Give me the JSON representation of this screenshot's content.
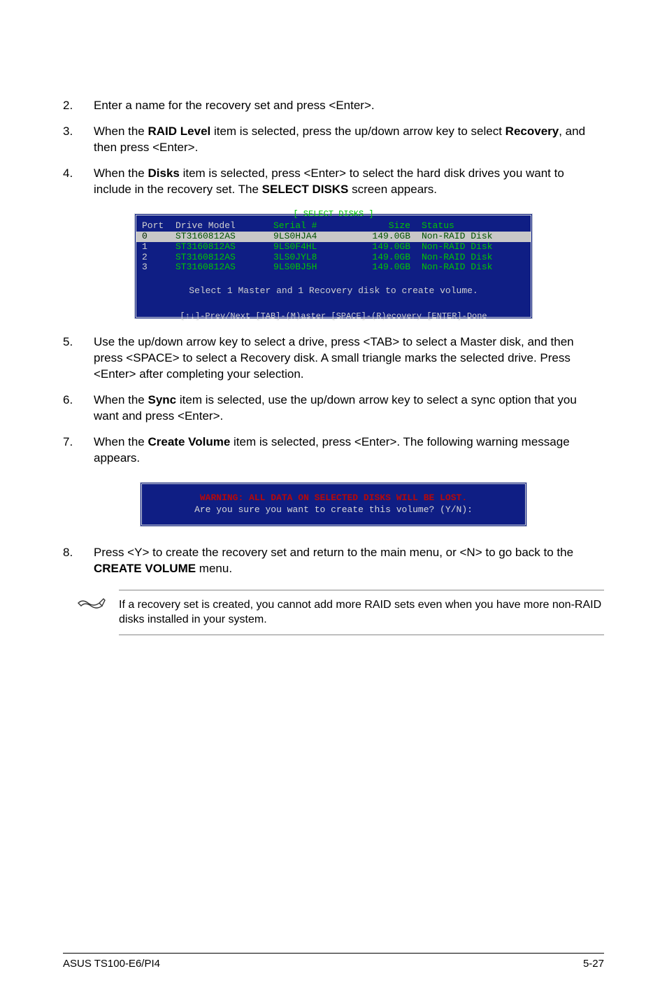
{
  "steps": {
    "s2": {
      "num": "2.",
      "text_a": "Enter a name for the recovery set and press <Enter>."
    },
    "s3": {
      "num": "3.",
      "text_a": "When the ",
      "b1": "RAID Level",
      "text_b": " item is selected, press the up/down arrow key to select ",
      "b2": "Recovery",
      "text_c": ", and then press <Enter>."
    },
    "s4": {
      "num": "4.",
      "text_a": "When the ",
      "b1": "Disks",
      "text_b": " item is selected, press <Enter> to select the hard disk drives you want to include in the recovery set. The ",
      "b2": "SELECT DISKS",
      "text_c": " screen appears."
    },
    "s5": {
      "num": "5.",
      "text_a": "Use the up/down arrow key to select a drive, press <TAB> to select a Master disk, and then press <SPACE> to select a Recovery disk. A small triangle marks the selected drive. Press <Enter> after completing your selection."
    },
    "s6": {
      "num": "6.",
      "text_a": "When the ",
      "b1": "Sync",
      "text_b": " item is selected, use the up/down arrow key to select a sync option that you want and press <Enter>."
    },
    "s7": {
      "num": "7.",
      "text_a": "When the ",
      "b1": "Create Volume",
      "text_b": " item is selected, press <Enter>. The following warning message appears."
    },
    "s8": {
      "num": "8.",
      "text_a": "Press <Y> to create the recovery set and return to the main menu, or <N> to go back to the ",
      "b1": "CREATE VOLUME",
      "text_b": " menu."
    }
  },
  "terminal": {
    "title": "[ SELECT DISKS ]",
    "headers": {
      "port": "Port",
      "model": "Drive Model",
      "serial": "Serial #",
      "size": "Size",
      "status": "Status"
    },
    "rows": [
      {
        "port": "0",
        "model": "ST3160812AS",
        "serial": "9LS0HJA4",
        "size": "149.0GB",
        "status": "Non-RAID Disk"
      },
      {
        "port": "1",
        "model": "ST3160812AS",
        "serial": "9LS0F4HL",
        "size": "149.0GB",
        "status": "Non-RAID Disk"
      },
      {
        "port": "2",
        "model": "ST3160812AS",
        "serial": "3LS0JYL8",
        "size": "149.0GB",
        "status": "Non-RAID Disk"
      },
      {
        "port": "3",
        "model": "ST3160812AS",
        "serial": "9LS0BJ5H",
        "size": "149.0GB",
        "status": "Non-RAID Disk"
      }
    ],
    "msg": "Select 1 Master and 1 Recovery disk to create volume.",
    "footer": "[↑↓]-Prev/Next [TAB]-(M)aster [SPACE]-(R)ecovery [ENTER]-Done"
  },
  "warn": {
    "line": "WARNING: ALL DATA ON SELECTED DISKS WILL BE LOST.",
    "prompt": "Are you sure you want to create this volume? (Y/N):"
  },
  "note": "If a recovery set is created, you cannot add more RAID sets even when you have more non-RAID disks installed in your system.",
  "footer": {
    "left": "ASUS TS100-E6/PI4",
    "right": "5-27"
  }
}
